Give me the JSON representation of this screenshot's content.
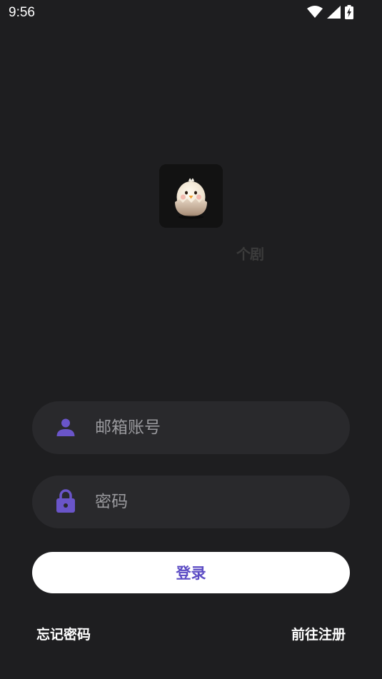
{
  "status_bar": {
    "time": "9:56",
    "icons": [
      "wifi-icon",
      "cellular-signal-icon",
      "battery-charging-icon"
    ]
  },
  "app": {
    "logo_icon": "chick-in-eggshell-icon",
    "name": "个剧"
  },
  "login_form": {
    "email_placeholder": "邮箱账号",
    "email_value": "",
    "email_icon": "person-icon",
    "password_placeholder": "密码",
    "password_value": "",
    "password_icon": "lock-icon",
    "submit_label": "登录"
  },
  "links": {
    "forgot_password": "忘记密码",
    "register": "前往注册"
  },
  "colors": {
    "background": "#1e1e20",
    "field_background": "#29292c",
    "accent": "#5b4bc4",
    "button_background": "#ffffff"
  }
}
